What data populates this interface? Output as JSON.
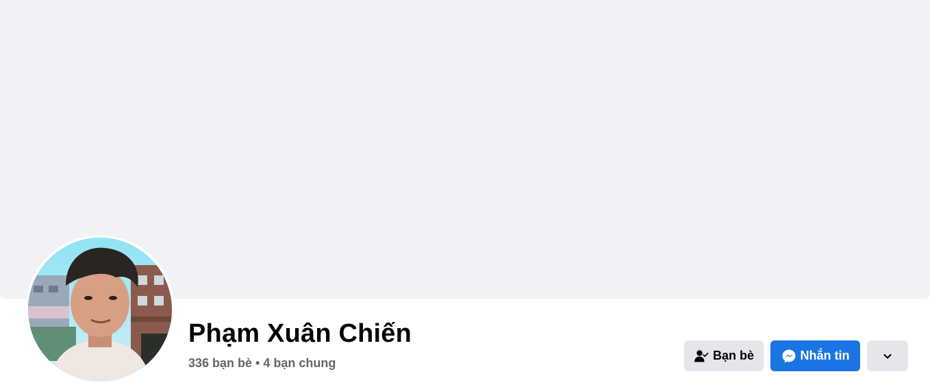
{
  "profile": {
    "name": "Phạm Xuân Chiến",
    "friends_count": "336 bạn bè",
    "separator": "•",
    "mutual_friends": "4 bạn chung"
  },
  "actions": {
    "friends_label": "Bạn bè",
    "message_label": "Nhắn tin"
  },
  "icons": {
    "friends": "person-check-icon",
    "message": "messenger-icon",
    "more": "chevron-down-icon"
  },
  "colors": {
    "cover_bg": "#f0f2f5",
    "primary_button": "#1b74e4",
    "secondary_button": "#e4e6eb",
    "name_text": "#050505",
    "meta_text": "#65676b"
  }
}
